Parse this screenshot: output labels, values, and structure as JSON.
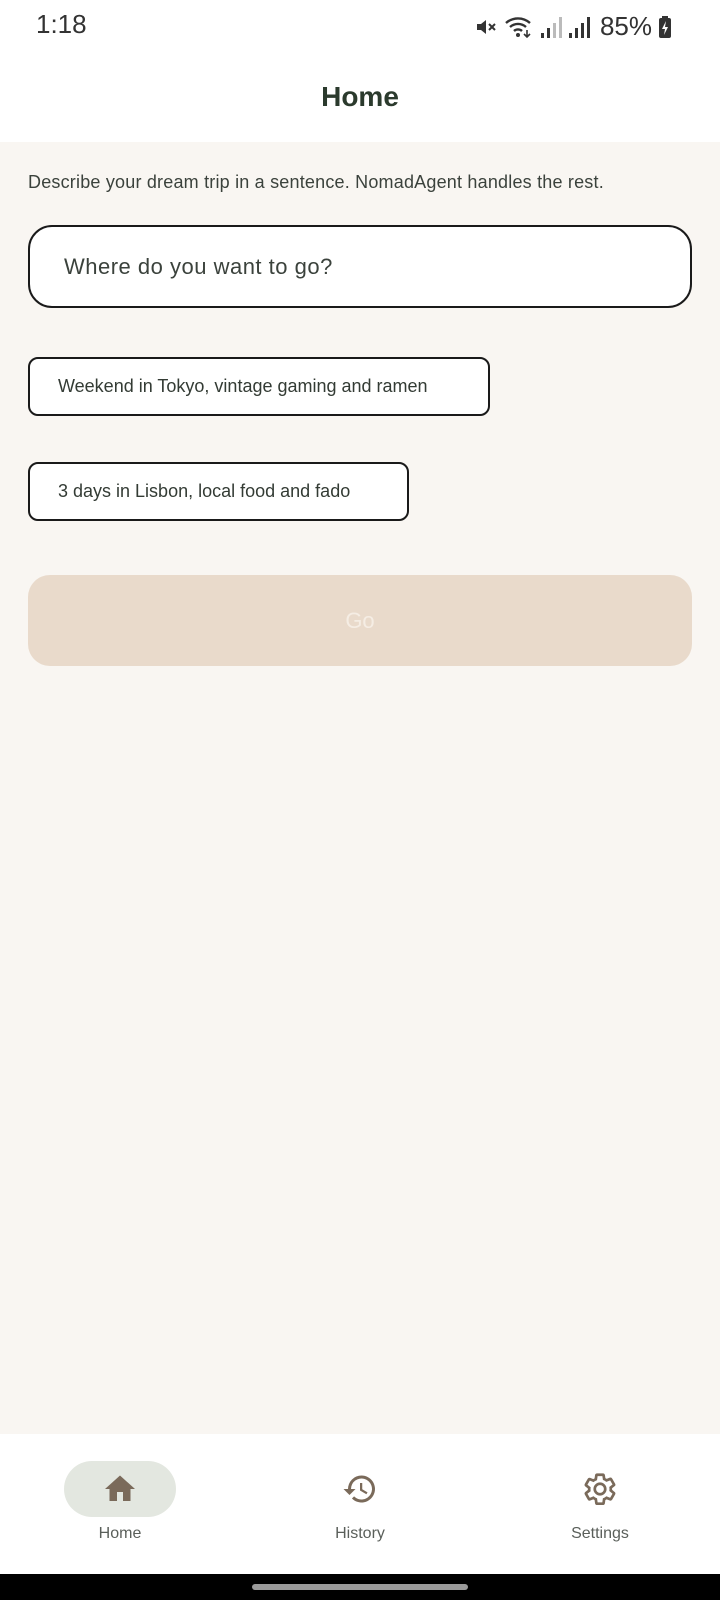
{
  "status_bar": {
    "time": "1:18",
    "battery_percent": "85%",
    "icons": [
      "mute-icon",
      "wifi-icon",
      "signal-icon",
      "signal-icon",
      "battery-charging-icon"
    ]
  },
  "header": {
    "title": "Home"
  },
  "main": {
    "intro": "Describe your dream trip in a sentence. NomadAgent handles the rest.",
    "search": {
      "placeholder": "Where do you want to go?",
      "value": ""
    },
    "suggestions": [
      "Weekend in Tokyo, vintage gaming and ramen",
      "3 days in Lisbon, local food and fado"
    ],
    "go_label": "Go"
  },
  "bottom_nav": {
    "items": [
      {
        "label": "Home",
        "icon": "home-icon",
        "selected": true
      },
      {
        "label": "History",
        "icon": "history-icon",
        "selected": false
      },
      {
        "label": "Settings",
        "icon": "gear-icon",
        "selected": false
      }
    ]
  },
  "colors": {
    "background": "#f9f6f2",
    "go_button_disabled": "#e9dacb",
    "nav_selected_pill": "#e3e7e0",
    "nav_icon": "#7a6a5a"
  }
}
